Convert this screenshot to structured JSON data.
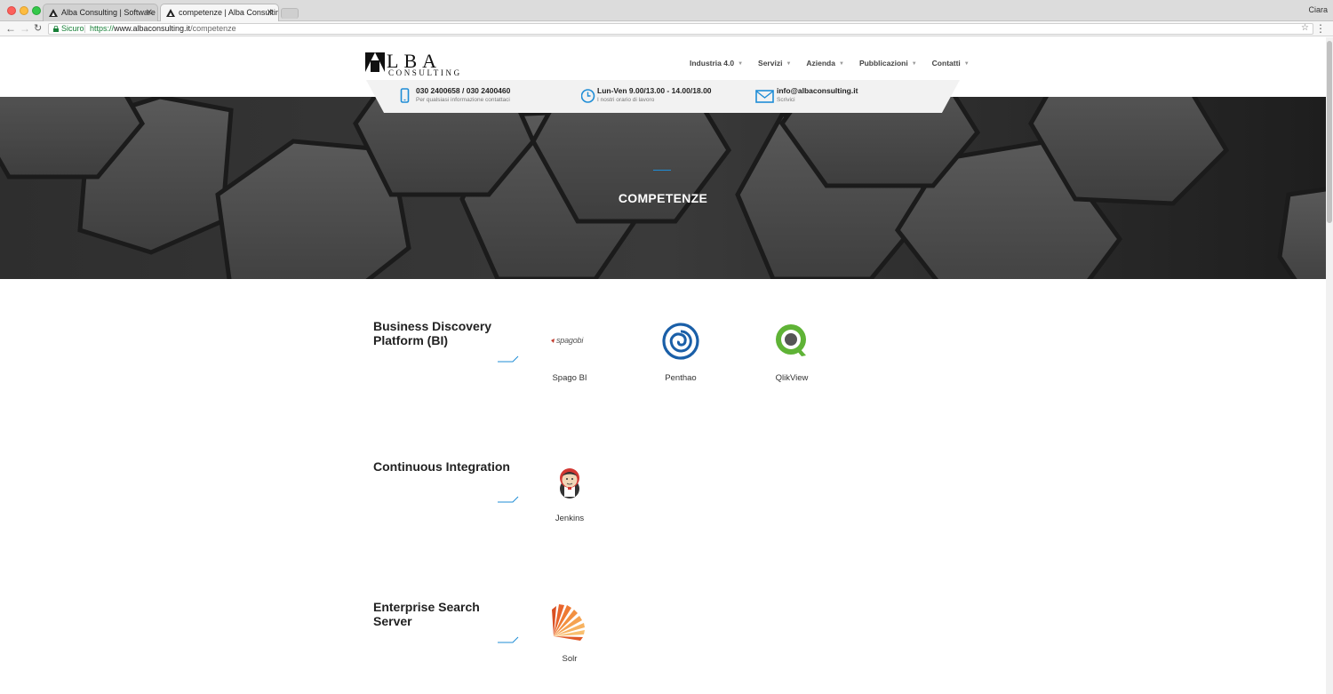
{
  "browser": {
    "tabs": [
      {
        "title": "Alba Consulting | Software ho",
        "active": false
      },
      {
        "title": "competenze | Alba Consulting",
        "active": true
      }
    ],
    "profile_name": "Ciara",
    "secure_label": "Sicuro",
    "url": {
      "protocol": "https://",
      "host": "www.albaconsulting.it",
      "path": "/competenze"
    }
  },
  "header": {
    "logo_word": "LBA",
    "logo_sub": "CONSULTING",
    "nav": [
      {
        "label": "Industria 4.0"
      },
      {
        "label": "Servizi"
      },
      {
        "label": "Azienda"
      },
      {
        "label": "Pubblicazioni"
      },
      {
        "label": "Contatti"
      }
    ],
    "info": [
      {
        "icon": "phone-icon",
        "title": "030 2400658 / 030 2400460",
        "sub": "Per qualsiasi informazione contattaci"
      },
      {
        "icon": "clock-icon",
        "title": "Lun-Ven 9.00/13.00 - 14.00/18.00",
        "sub": "I nostri orario di lavoro"
      },
      {
        "icon": "envelope-icon",
        "title": "info@albaconsulting.it",
        "sub": "Scrivici"
      }
    ]
  },
  "hero": {
    "title": "COMPETENZE"
  },
  "sections": [
    {
      "title": "Business Discovery Platform (BI)",
      "items": [
        {
          "label": "Spago BI",
          "logo_text": "spagobi",
          "icon": "spagobi-logo"
        },
        {
          "label": "Penthao",
          "icon": "pentaho-spiral-logo"
        },
        {
          "label": "QlikView",
          "icon": "qlikview-logo"
        }
      ]
    },
    {
      "title": "Continuous Integration",
      "items": [
        {
          "label": "Jenkins",
          "icon": "jenkins-logo"
        }
      ]
    },
    {
      "title": "Enterprise Search Server",
      "items": [
        {
          "label": "Solr",
          "icon": "solr-logo"
        }
      ]
    }
  ],
  "colors": {
    "accent": "#1f8dd6",
    "qlik_green": "#5fb336",
    "pentaho_blue": "#1a5fa8",
    "solr_orange": "#e8642c"
  }
}
